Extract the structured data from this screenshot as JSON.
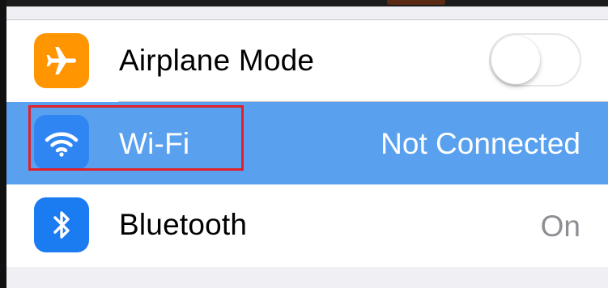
{
  "colors": {
    "airplane_icon_bg": "#ff9500",
    "wifi_icon_bg": "#2f86f2",
    "bluetooth_icon_bg": "#1a7cf0",
    "selected_row_bg": "#59a0ef",
    "highlight_border": "#e0202a"
  },
  "settings": {
    "rows": [
      {
        "label": "Airplane Mode",
        "icon": "airplane-icon",
        "control": "toggle",
        "toggle_on": false
      },
      {
        "label": "Wi-Fi",
        "icon": "wifi-icon",
        "value": "Not Connected",
        "selected": true,
        "highlighted": true
      },
      {
        "label": "Bluetooth",
        "icon": "bluetooth-icon",
        "value": "On"
      }
    ]
  }
}
